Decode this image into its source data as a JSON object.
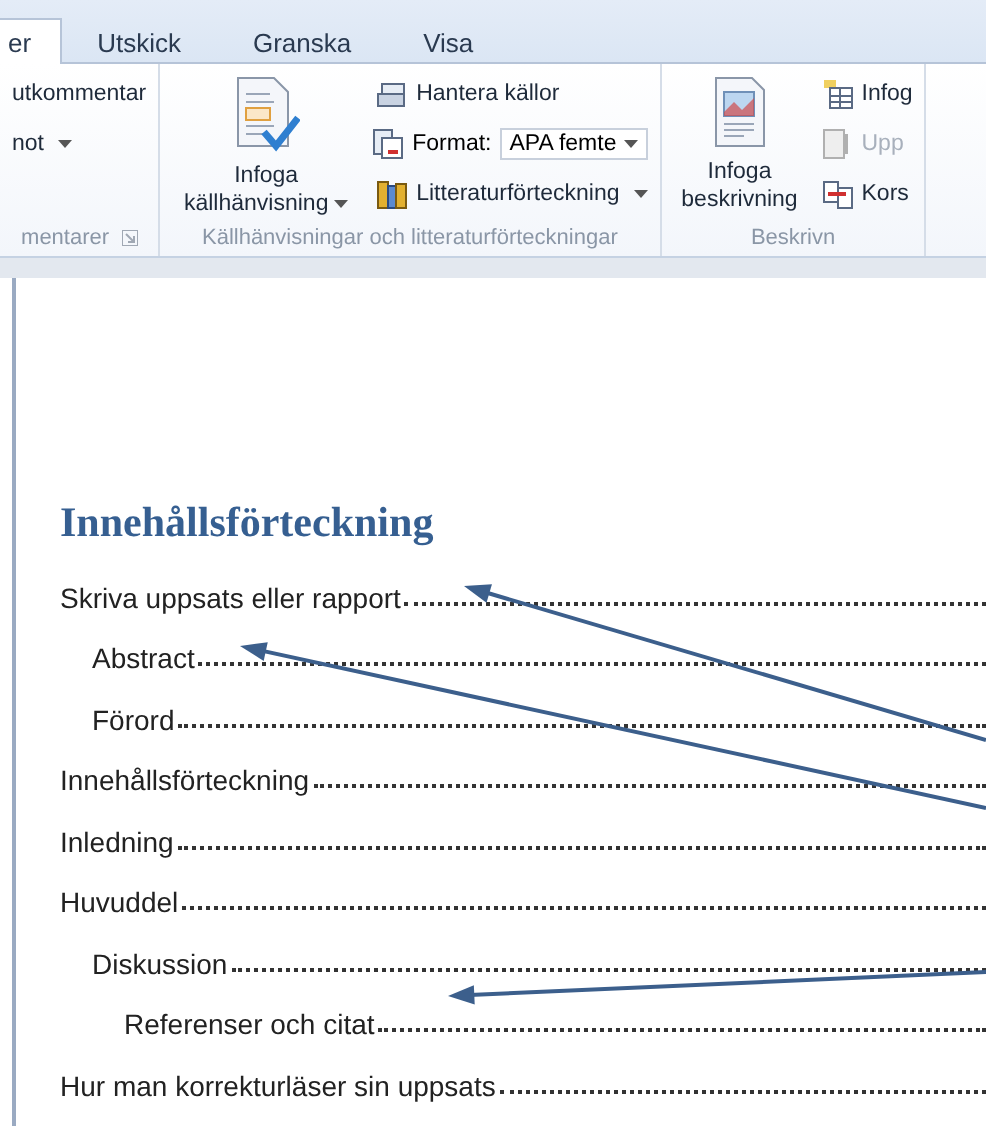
{
  "tabs": [
    {
      "label": "er",
      "selected": true
    },
    {
      "label": "Utskick",
      "selected": false
    },
    {
      "label": "Granska",
      "selected": false
    },
    {
      "label": "Visa",
      "selected": false
    }
  ],
  "ribbon": {
    "groups": [
      {
        "label": "mentarer",
        "items": [
          {
            "kind": "small",
            "label": "utkommentar",
            "dropdown": false,
            "disabled": false
          },
          {
            "kind": "small",
            "label": "not",
            "dropdown": true,
            "disabled": false
          }
        ]
      },
      {
        "label": "Källhänvisningar och litteraturförteckningar",
        "items": [
          {
            "kind": "large",
            "label": "Infoga källhänvisning",
            "dropdown": true
          },
          {
            "kind": "small",
            "label": "Hantera källor",
            "dropdown": false,
            "disabled": false
          },
          {
            "kind": "combo",
            "label": "Format:",
            "value": "APA femte"
          },
          {
            "kind": "small",
            "label": "Litteraturförteckning",
            "dropdown": true,
            "disabled": false
          }
        ]
      },
      {
        "label": "Beskrivn",
        "items": [
          {
            "kind": "large",
            "label": "Infoga beskrivning",
            "dropdown": false
          },
          {
            "kind": "small",
            "label": "Infog",
            "dropdown": false,
            "disabled": false
          },
          {
            "kind": "small",
            "label": "Upp",
            "dropdown": false,
            "disabled": true
          },
          {
            "kind": "small",
            "label": "Kors",
            "dropdown": false,
            "disabled": false
          }
        ]
      }
    ]
  },
  "document": {
    "heading": "Innehållsförteckning",
    "toc": [
      {
        "text": "Skriva uppsats eller rapport",
        "children": [
          {
            "text": "Abstract"
          },
          {
            "text": "Förord"
          }
        ]
      },
      {
        "text": "Innehållsförteckning"
      },
      {
        "text": "Inledning"
      },
      {
        "text": "Huvuddel",
        "children": [
          {
            "text": "Diskussion",
            "children": [
              {
                "text": "Referenser och citat"
              }
            ]
          }
        ]
      },
      {
        "text": "Hur man korrekturläser sin uppsats"
      }
    ]
  }
}
